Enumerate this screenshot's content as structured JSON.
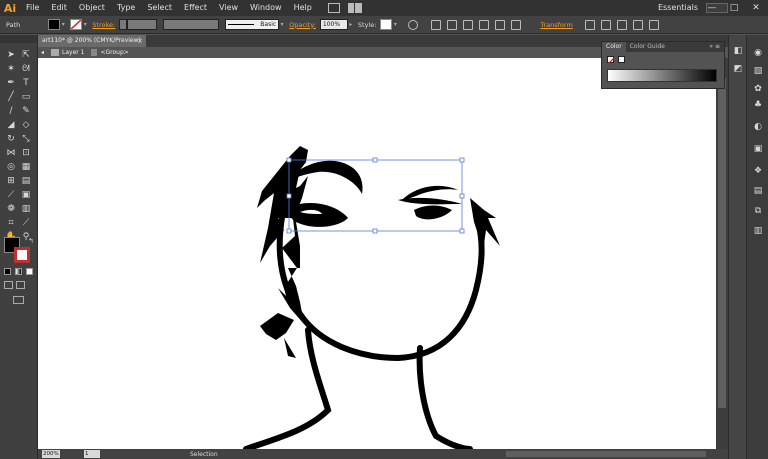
{
  "app": {
    "logo": "Ai"
  },
  "menubar": {
    "items": [
      "File",
      "Edit",
      "Object",
      "Type",
      "Select",
      "Effect",
      "View",
      "Window",
      "Help"
    ],
    "workspace": "Essentials",
    "window_controls": {
      "minimize": "—",
      "maximize": "□",
      "close": "✕"
    }
  },
  "controlbar": {
    "selection_type": "Path",
    "stroke_label": "Stroke:",
    "stroke_profile": "Basic",
    "opacity_label": "Opacity:",
    "opacity_value": "100%",
    "style_label": "Style:",
    "transform_label": "Transform"
  },
  "document": {
    "tab_title": "art110* @ 200% (CMYK/Preview)",
    "tab_close": "×",
    "breadcrumb_layer": "Layer 1",
    "breadcrumb_group": "<Group>"
  },
  "status": {
    "zoom": "200%",
    "page": "1",
    "tool": "Selection"
  },
  "color_panel": {
    "tabs": [
      "Color",
      "Color Guide"
    ],
    "controls": "»  ≡"
  },
  "icons": {
    "tools": [
      "selection-tool-icon",
      "direct-selection-tool-icon",
      "magic-wand-tool-icon",
      "lasso-tool-icon",
      "pen-tool-icon",
      "type-tool-icon",
      "line-segment-tool-icon",
      "rectangle-tool-icon",
      "paintbrush-tool-icon",
      "pencil-tool-icon",
      "blob-brush-tool-icon",
      "eraser-tool-icon",
      "rotate-tool-icon",
      "scale-tool-icon",
      "width-tool-icon",
      "free-transform-tool-icon",
      "shape-builder-tool-icon",
      "perspective-grid-tool-icon",
      "mesh-tool-icon",
      "gradient-tool-icon",
      "eyedropper-tool-icon",
      "blend-tool-icon",
      "symbol-sprayer-tool-icon",
      "column-graph-tool-icon",
      "artboard-tool-icon",
      "slice-tool-icon",
      "hand-tool-icon",
      "zoom-tool-icon"
    ]
  }
}
